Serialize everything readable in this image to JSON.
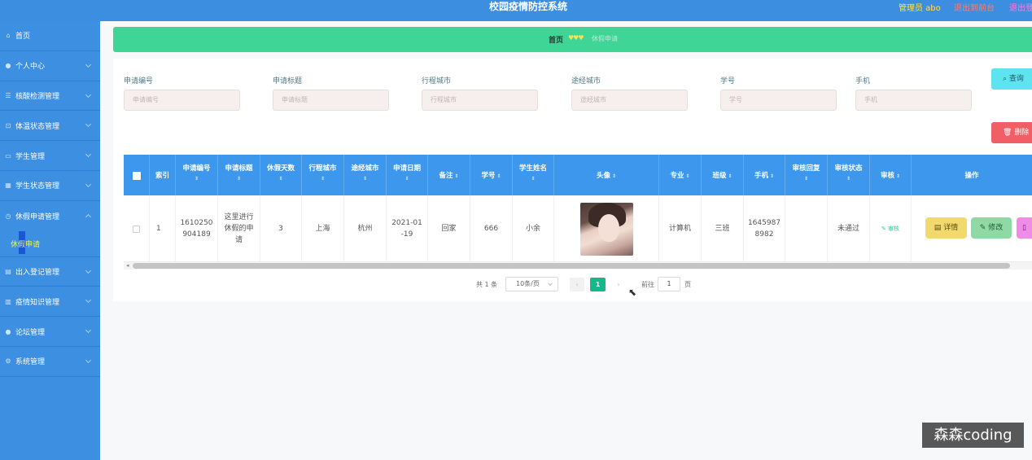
{
  "header": {
    "title": "校园疫情防控系统",
    "user": "管理员 abo",
    "back_link": "退出到前台",
    "logout_link": "退出登录"
  },
  "sidebar": {
    "items": [
      {
        "label": "首页",
        "icon": "home-icon"
      },
      {
        "label": "个人中心",
        "icon": "user-icon"
      },
      {
        "label": "核酸检测管理",
        "icon": "list-icon"
      },
      {
        "label": "体温状态管理",
        "icon": "thermometer-icon"
      },
      {
        "label": "学生管理",
        "icon": "id-card-icon"
      },
      {
        "label": "学生状态管理",
        "icon": "grid-icon"
      },
      {
        "label": "休假申请管理",
        "icon": "clock-icon"
      },
      {
        "label": "出入登记管理",
        "icon": "book-icon"
      },
      {
        "label": "疫情知识管理",
        "icon": "chart-icon"
      },
      {
        "label": "论坛管理",
        "icon": "person-icon"
      },
      {
        "label": "系统管理",
        "icon": "gear-icon"
      }
    ],
    "active_sub": "休假申请"
  },
  "breadcrumb": {
    "home": "首页",
    "hearts": "♥♥♥",
    "current": "休假申请"
  },
  "filters": [
    {
      "label": "申请编号",
      "placeholder": "申请编号"
    },
    {
      "label": "申请标题",
      "placeholder": "申请标题"
    },
    {
      "label": "行程城市",
      "placeholder": "行程城市"
    },
    {
      "label": "途经城市",
      "placeholder": "途经城市"
    },
    {
      "label": "学号",
      "placeholder": "学号"
    },
    {
      "label": "手机",
      "placeholder": "手机"
    }
  ],
  "buttons": {
    "search": "查询",
    "delete": "删除"
  },
  "table": {
    "columns": [
      "索引",
      "申请编号",
      "申请标题",
      "休假天数",
      "行程城市",
      "途经城市",
      "申请日期",
      "备注",
      "学号",
      "学生姓名",
      "头像",
      "专业",
      "班级",
      "手机",
      "审核回复",
      "审核状态",
      "审核",
      "操作"
    ],
    "sort_glyph": "⇕",
    "rows": [
      {
        "index": "1",
        "apply_no": "1610250904189",
        "apply_no_l1": "1610250",
        "apply_no_l2": "904189",
        "title_l1": "这里进行",
        "title_l2": "休假的申",
        "title_l3": "请",
        "days": "3",
        "trip_city": "上海",
        "via_city": "杭州",
        "date_l1": "2021-01",
        "date_l2": "-19",
        "remark": "回家",
        "student_no": "666",
        "student_name": "小余",
        "major": "计算机",
        "class": "三班",
        "phone_l1": "1645987",
        "phone_l2": "8982",
        "reply": "",
        "status": "未通过",
        "review_link": "审核"
      }
    ],
    "actions": {
      "detail": "详情",
      "edit": "修改"
    }
  },
  "pagination": {
    "total": "共 1 条",
    "page_size": "10条/页",
    "current": "1",
    "goto_label": "前往",
    "goto_value": "1",
    "unit": "页"
  },
  "watermark": "森森coding",
  "colors": {
    "header": "#3c8fe0",
    "sidebar": "#3d8fe2",
    "breadcrumb": "#3ed597",
    "table_header": "#3d97ec",
    "search_btn": "#5ee4ee",
    "delete_btn": "#ef5f65",
    "detail_btn": "#f1d96e",
    "edit_btn": "#8fd9a5",
    "third_btn": "#ee8ce6"
  }
}
